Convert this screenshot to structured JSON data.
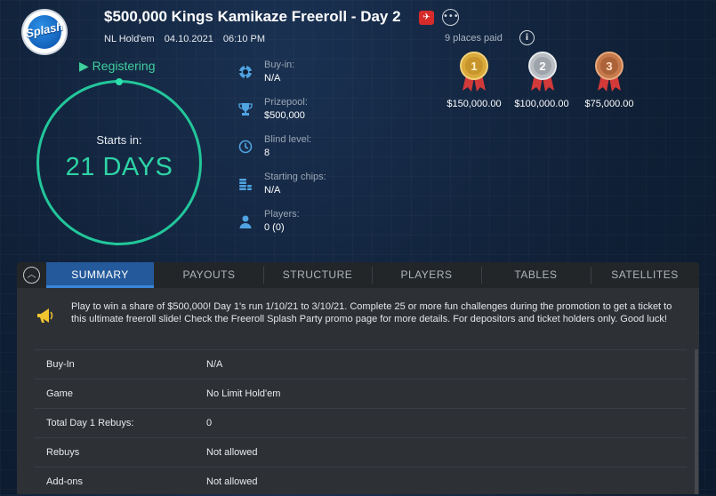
{
  "header": {
    "logo_text": "Splash",
    "title": "$500,000 Kings Kamikaze Freeroll - Day 2",
    "game": "NL Hold'em",
    "date": "04.10.2021",
    "time": "06:10 PM"
  },
  "status": {
    "label": "Registering",
    "starts_label": "Starts in:",
    "starts_value": "21 DAYS"
  },
  "info": [
    {
      "label": "Buy-in:",
      "value": "N/A",
      "icon": "poker-chip-icon"
    },
    {
      "label": "Prizepool:",
      "value": "$500,000",
      "icon": "trophy-icon"
    },
    {
      "label": "Blind level:",
      "value": "8",
      "icon": "clock-icon"
    },
    {
      "label": "Starting chips:",
      "value": "N/A",
      "icon": "chip-stack-icon"
    },
    {
      "label": "Players:",
      "value": "0 (0)",
      "icon": "user-icon"
    }
  ],
  "prizes": {
    "places_label": "9 places paid",
    "medals": [
      {
        "rank": "1",
        "amount": "$150,000.00",
        "color": "#d9a93a"
      },
      {
        "rank": "2",
        "amount": "$100,000.00",
        "color": "#b9bec4"
      },
      {
        "rank": "3",
        "amount": "$75,000.00",
        "color": "#c57a4c"
      }
    ]
  },
  "tabs": [
    "SUMMARY",
    "PAYOUTS",
    "STRUCTURE",
    "PLAYERS",
    "TABLES",
    "SATELLITES"
  ],
  "promo": "Play to win a share of $500,000! Day 1's run 1/10/21 to 3/10/21. Complete 25 or more fun challenges during the promotion to get a ticket to this ultimate freeroll slide! Check the Freeroll Splash Party promo page for more details. For depositors and ticket holders only. Good luck!",
  "summary_rows": [
    {
      "key": "Buy-In",
      "value": "N/A"
    },
    {
      "key": "Game",
      "value": "No Limit Hold'em"
    },
    {
      "key": "Total Day 1 Rebuys:",
      "value": "0"
    },
    {
      "key": "Rebuys",
      "value": "Not allowed"
    },
    {
      "key": "Add-ons",
      "value": "Not allowed"
    }
  ],
  "colors": {
    "accent_green": "#2dd3a5",
    "tab_active": "#245a9b",
    "icon_blue": "#4fa3e0"
  }
}
